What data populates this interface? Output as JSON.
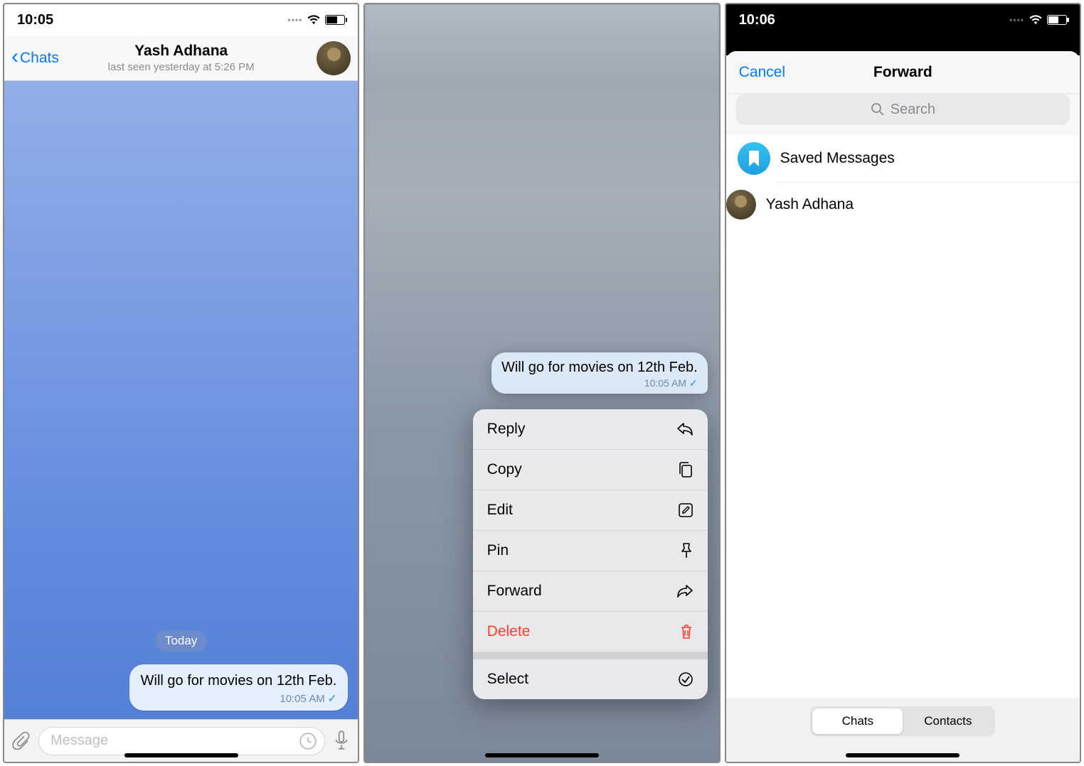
{
  "screen1": {
    "status_time": "10:05",
    "back_label": "Chats",
    "contact_name": "Yash Adhana",
    "last_seen": "last seen yesterday at 5:26 PM",
    "date_label": "Today",
    "message_text": "Will go for movies on 12th Feb.",
    "message_time": "10:05 AM",
    "input_placeholder": "Message"
  },
  "screen2": {
    "message_text": "Will go for movies on 12th Feb.",
    "message_time": "10:05 AM",
    "menu": {
      "reply": "Reply",
      "copy": "Copy",
      "edit": "Edit",
      "pin": "Pin",
      "forward": "Forward",
      "delete": "Delete",
      "select": "Select"
    }
  },
  "screen3": {
    "status_time": "10:06",
    "cancel_label": "Cancel",
    "title": "Forward",
    "search_placeholder": "Search",
    "rows": {
      "saved": "Saved Messages",
      "contact": "Yash Adhana"
    },
    "segments": {
      "chats": "Chats",
      "contacts": "Contacts"
    }
  }
}
